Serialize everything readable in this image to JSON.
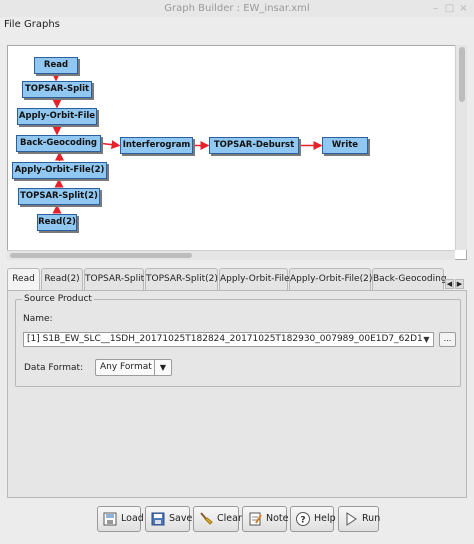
{
  "window": {
    "title": "Graph Builder : EW_insar.xml"
  },
  "menu": [
    "File",
    "Graphs"
  ],
  "graph": {
    "nodes": [
      {
        "id": "read",
        "label": "Read"
      },
      {
        "id": "topsar-split",
        "label": "TOPSAR-Split"
      },
      {
        "id": "apply-orbit-file",
        "label": "Apply-Orbit-File"
      },
      {
        "id": "back-geocoding",
        "label": "Back-Geocoding"
      },
      {
        "id": "apply-orbit-file-2",
        "label": "Apply-Orbit-File(2)"
      },
      {
        "id": "topsar-split-2",
        "label": "TOPSAR-Split(2)"
      },
      {
        "id": "read-2",
        "label": "Read(2)"
      },
      {
        "id": "interferogram",
        "label": "Interferogram"
      },
      {
        "id": "topsar-deburst",
        "label": "TOPSAR-Deburst"
      },
      {
        "id": "write",
        "label": "Write"
      }
    ],
    "edges": [
      [
        "read",
        "topsar-split"
      ],
      [
        "topsar-split",
        "apply-orbit-file"
      ],
      [
        "apply-orbit-file",
        "back-geocoding"
      ],
      [
        "read-2",
        "topsar-split-2"
      ],
      [
        "topsar-split-2",
        "apply-orbit-file-2"
      ],
      [
        "apply-orbit-file-2",
        "back-geocoding"
      ],
      [
        "back-geocoding",
        "interferogram"
      ],
      [
        "interferogram",
        "topsar-deburst"
      ],
      [
        "topsar-deburst",
        "write"
      ]
    ],
    "edge_color": "#e8202a",
    "node_fill": "#91c8f1"
  },
  "tabs": [
    "Read",
    "Read(2)",
    "TOPSAR-Split",
    "TOPSAR-Split(2)",
    "Apply-Orbit-File",
    "Apply-Orbit-File(2)",
    "Back-Geocoding"
  ],
  "active_tab": "Read",
  "source_product": {
    "group_title": "Source Product",
    "name_label": "Name:",
    "name_value": "[1] S1B_EW_SLC__1SDH_20171025T182824_20171025T182930_007989_00E1D7_62D1",
    "browse_label": "...",
    "format_label": "Data Format:",
    "format_value": "Any Format"
  },
  "buttons": {
    "load": "Load",
    "save": "Save",
    "clear": "Clear",
    "note": "Note",
    "help": "Help",
    "run": "Run"
  }
}
